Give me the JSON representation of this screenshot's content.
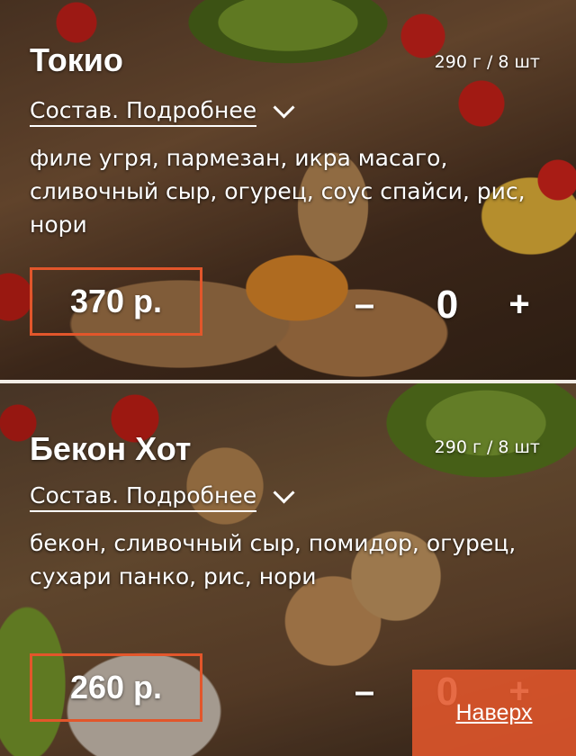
{
  "products": [
    {
      "title": "Токио",
      "weight": "290 г / 8 шт",
      "details_label": "Состав. Подробнее",
      "ingredients": "филе угря, пармезан, икра масаго, сливочный сыр, огурец, соус спайси, рис, нори",
      "price": "370 р.",
      "minus": "–",
      "quantity": "0",
      "plus": "+"
    },
    {
      "title": "Бекон Хот",
      "weight": "290 г / 8 шт",
      "details_label": "Состав. Подробнее",
      "ingredients": "бекон, сливочный сыр, помидор, огурец, сухари панко, рис, нори",
      "price": "260 р.",
      "minus": "–",
      "quantity": "0",
      "plus": "+"
    }
  ],
  "scroll_top_label": "Наверх",
  "colors": {
    "accent": "#e2562b",
    "text": "#ffffff"
  }
}
